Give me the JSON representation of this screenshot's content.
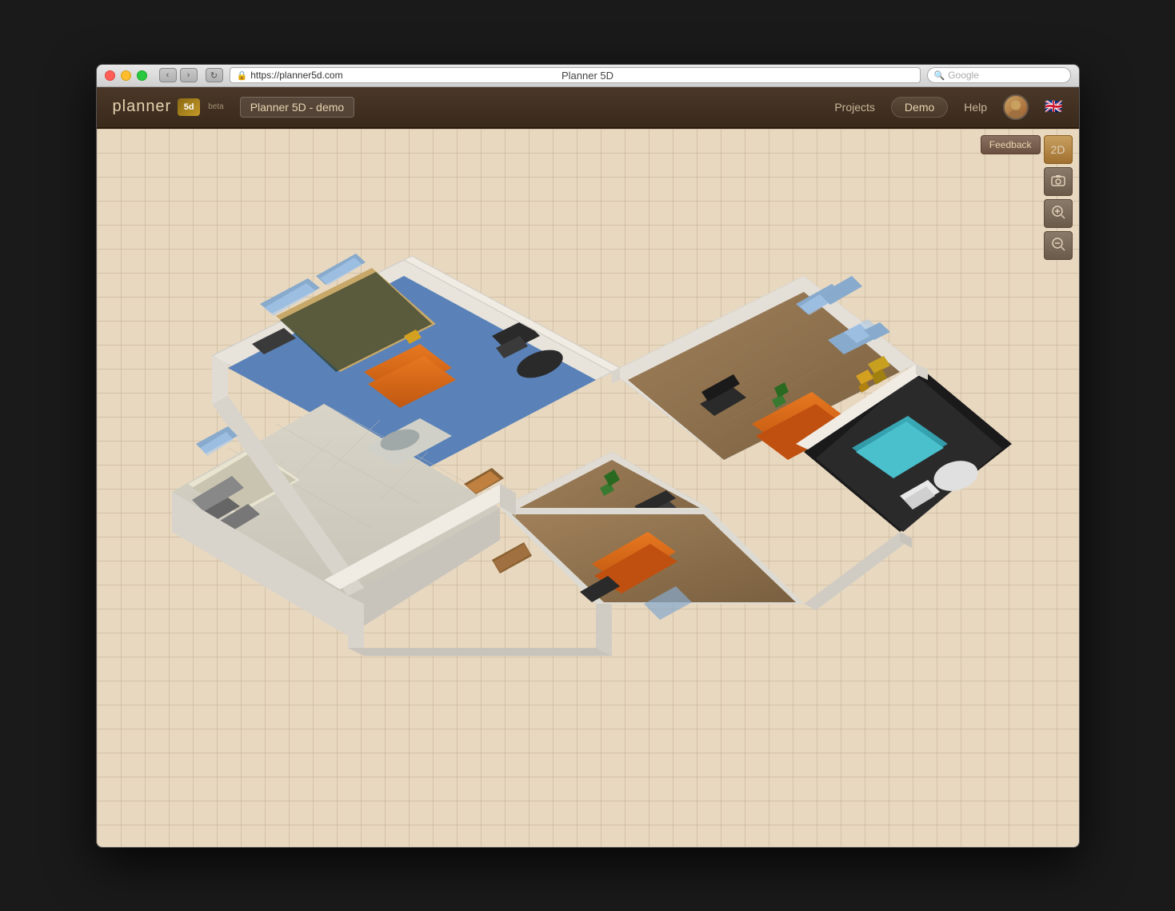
{
  "window": {
    "title": "Planner 5D",
    "url": "https://planner5d.com",
    "search_placeholder": "Google"
  },
  "header": {
    "logo_text": "planner",
    "logo_box": "5d",
    "beta": "beta",
    "project_name": "Planner 5D - demo",
    "nav": {
      "projects": "Projects",
      "demo": "Demo",
      "help": "Help"
    }
  },
  "canvas": {
    "feedback_label": "Feedback",
    "toolbar": {
      "view2d": "2D",
      "screenshot": "📷",
      "zoom_in": "🔍+",
      "zoom_out": "🔍-"
    }
  }
}
